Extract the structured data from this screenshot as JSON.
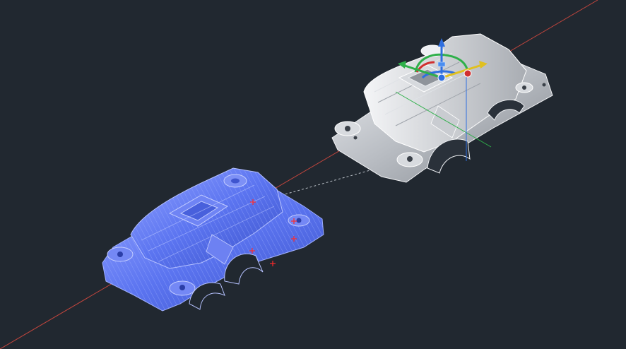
{
  "viewport": {
    "background": "#212830",
    "axis_line_color": "#c0453d",
    "movement_path_color": "#b9bfc6"
  },
  "parts": {
    "selected_part_color": "#5b74f0",
    "selected_part_outline": "#8fa0ff",
    "moved_part_color": "#c8ccd2",
    "moved_part_outline": "#ffffff"
  },
  "gizmo": {
    "x_axis_color": "#e0c020",
    "y_axis_color": "#2fb04a",
    "z_axis_color": "#2f6fe0",
    "center_color": "#d03030",
    "icons": [
      "move-rotate-gizmo-icon"
    ]
  },
  "grips": {
    "color": "#ff2a2a"
  }
}
